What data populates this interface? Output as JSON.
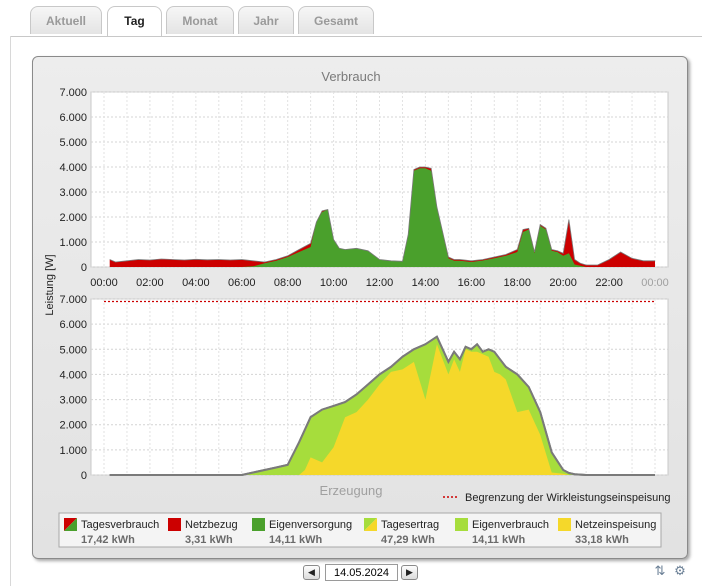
{
  "tabs": [
    "Aktuell",
    "Tag",
    "Monat",
    "Jahr",
    "Gesamt"
  ],
  "active_tab": "Tag",
  "chart_data": [
    {
      "type": "area",
      "title": "Verbrauch",
      "ylabel": "Leistung [W]",
      "ylim": [
        0,
        7000
      ],
      "yticks": [
        "0",
        "1.000",
        "2.000",
        "3.000",
        "4.000",
        "5.000",
        "6.000",
        "7.000"
      ],
      "xticks": [
        "00:00",
        "02:00",
        "04:00",
        "06:00",
        "08:00",
        "10:00",
        "12:00",
        "14:00",
        "16:00",
        "18:00",
        "20:00",
        "22:00",
        "00:00"
      ],
      "x": [
        0.25,
        0.5,
        1,
        1.5,
        2,
        2.5,
        3,
        3.5,
        4,
        4.5,
        5,
        5.5,
        6,
        6.5,
        7,
        7.5,
        8,
        8.5,
        9,
        9.25,
        9.5,
        9.75,
        10,
        10.25,
        10.5,
        11,
        11.5,
        12,
        12.5,
        13,
        13.25,
        13.5,
        13.75,
        14,
        14.25,
        14.5,
        15,
        15.25,
        15.5,
        16,
        16.5,
        17,
        17.5,
        18,
        18.25,
        18.5,
        18.75,
        19,
        19.25,
        19.5,
        19.75,
        20,
        20.25,
        20.5,
        20.75,
        21,
        21.5,
        22,
        22.5,
        23,
        23.5,
        24
      ],
      "series": [
        {
          "name": "Tagesverbrauch",
          "color": "#cc0000",
          "values": [
            300,
            200,
            250,
            300,
            280,
            320,
            300,
            280,
            310,
            290,
            300,
            280,
            300,
            250,
            200,
            300,
            450,
            700,
            950,
            1800,
            2250,
            2300,
            1100,
            750,
            700,
            750,
            650,
            300,
            250,
            230,
            1300,
            3900,
            4000,
            4000,
            3950,
            2400,
            400,
            300,
            300,
            250,
            300,
            400,
            500,
            700,
            1500,
            1550,
            600,
            1700,
            1550,
            700,
            650,
            550,
            1900,
            300,
            150,
            80,
            80,
            300,
            600,
            350,
            250,
            250
          ]
        },
        {
          "name": "Eigenversorgung",
          "color": "#4aa02c",
          "values": [
            0,
            0,
            0,
            0,
            0,
            0,
            0,
            0,
            0,
            0,
            0,
            0,
            0,
            30,
            150,
            250,
            400,
            600,
            800,
            1800,
            2200,
            2300,
            1100,
            750,
            700,
            750,
            650,
            300,
            250,
            230,
            1300,
            3850,
            3950,
            3950,
            3850,
            2400,
            350,
            250,
            250,
            200,
            260,
            350,
            450,
            600,
            1400,
            1500,
            550,
            1650,
            1500,
            650,
            600,
            450,
            550,
            100,
            50,
            0,
            0,
            0,
            0,
            0,
            0,
            0
          ]
        }
      ],
      "legend": [
        {
          "label": "Tagesverbrauch",
          "value": "17,42 kWh",
          "swatch": "split",
          "colors": [
            "#cc0000",
            "#4aa02c"
          ]
        },
        {
          "label": "Netzbezug",
          "value": "3,31 kWh",
          "swatch": "solid",
          "colors": [
            "#cc0000"
          ]
        },
        {
          "label": "Eigenversorgung",
          "value": "14,11 kWh",
          "swatch": "solid",
          "colors": [
            "#4aa02c"
          ]
        }
      ]
    },
    {
      "type": "area",
      "title": "Erzeugung",
      "ylim": [
        0,
        7000
      ],
      "yticks": [
        "0",
        "1.000",
        "2.000",
        "3.000",
        "4.000",
        "5.000",
        "6.000",
        "7.000"
      ],
      "limit_line": {
        "label": "Begrenzung der Wirkleistungseinspeisung",
        "value": 6900,
        "color": "#cc0000"
      },
      "x": [
        0.25,
        1,
        2,
        3,
        4,
        5,
        6,
        6.5,
        7,
        7.5,
        8,
        8.5,
        8.75,
        9,
        9.5,
        10,
        10.5,
        11,
        11.5,
        12,
        12.5,
        13,
        13.5,
        14,
        14.5,
        15,
        15.25,
        15.5,
        15.75,
        16,
        16.25,
        16.5,
        16.75,
        17,
        17.25,
        17.5,
        18,
        18.5,
        19,
        19.5,
        20,
        20.25,
        20.5,
        21,
        21.5,
        22,
        23,
        24
      ],
      "series": [
        {
          "name": "Tagesertrag",
          "color": "#7a7a7a",
          "values": [
            0,
            0,
            0,
            0,
            0,
            0,
            0,
            100,
            200,
            300,
            400,
            1300,
            1800,
            2300,
            2600,
            2750,
            2900,
            3200,
            3600,
            4000,
            4300,
            4700,
            5000,
            5200,
            5500,
            4500,
            4900,
            4600,
            5100,
            5000,
            5200,
            4900,
            5000,
            4900,
            4600,
            4300,
            4000,
            3500,
            2500,
            900,
            200,
            80,
            30,
            0,
            0,
            0,
            0,
            0
          ]
        },
        {
          "name": "Eigenverbrauch",
          "color": "#a6dd3c",
          "values": [
            0,
            0,
            0,
            0,
            0,
            0,
            0,
            100,
            200,
            300,
            400,
            1300,
            1800,
            2300,
            2600,
            2750,
            2900,
            3200,
            3600,
            4000,
            4300,
            4700,
            5000,
            5200,
            5500,
            4500,
            4900,
            4600,
            5100,
            5000,
            5200,
            4900,
            5000,
            4900,
            4600,
            4300,
            4000,
            3500,
            2500,
            900,
            200,
            80,
            30,
            0,
            0,
            0,
            0,
            0
          ]
        },
        {
          "name": "Netzeinspeisung",
          "color": "#f5d82a",
          "values": [
            0,
            0,
            0,
            0,
            0,
            0,
            0,
            0,
            0,
            0,
            0,
            0,
            200,
            700,
            500,
            1100,
            2300,
            2500,
            3000,
            3600,
            4100,
            4200,
            4500,
            3000,
            5200,
            4000,
            4600,
            4100,
            5000,
            4900,
            4900,
            4800,
            4700,
            4100,
            4000,
            3800,
            2500,
            2600,
            1600,
            100,
            50,
            0,
            0,
            0,
            0,
            0,
            0,
            0
          ]
        }
      ],
      "legend": [
        {
          "label": "Tagesertrag",
          "value": "47,29 kWh",
          "swatch": "split",
          "colors": [
            "#a6dd3c",
            "#f5d82a"
          ]
        },
        {
          "label": "Eigenverbrauch",
          "value": "14,11 kWh",
          "swatch": "solid",
          "colors": [
            "#a6dd3c"
          ]
        },
        {
          "label": "Netzeinspeisung",
          "value": "33,18 kWh",
          "swatch": "solid",
          "colors": [
            "#f5d82a"
          ]
        }
      ]
    }
  ],
  "date_nav": {
    "date": "14.05.2024",
    "prev_icon": "arrow-left-icon",
    "next_icon": "arrow-right-icon"
  },
  "corner_icons": [
    "sort-icon",
    "settings-icon"
  ]
}
